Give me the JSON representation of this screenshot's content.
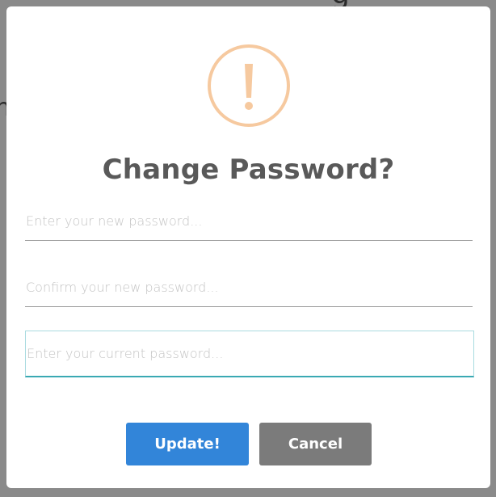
{
  "dialog": {
    "title": "Change Password?",
    "icon": "warning-exclamation-icon",
    "fields": {
      "new_password": {
        "placeholder": "Enter your new password...",
        "value": ""
      },
      "confirm_password": {
        "placeholder": "Confirm your new password...",
        "value": ""
      },
      "current_password": {
        "placeholder": "Enter your current password...",
        "value": ""
      }
    },
    "buttons": {
      "update": "Update!",
      "cancel": "Cancel"
    }
  },
  "background": {
    "fragment_top": "g",
    "fragment_left": "n"
  },
  "colors": {
    "warning": "#f6c99f",
    "primary": "#3285d9",
    "secondary": "#7b7b7b",
    "focus": "#3aa9b3",
    "overlay": "#8a8a8a"
  }
}
